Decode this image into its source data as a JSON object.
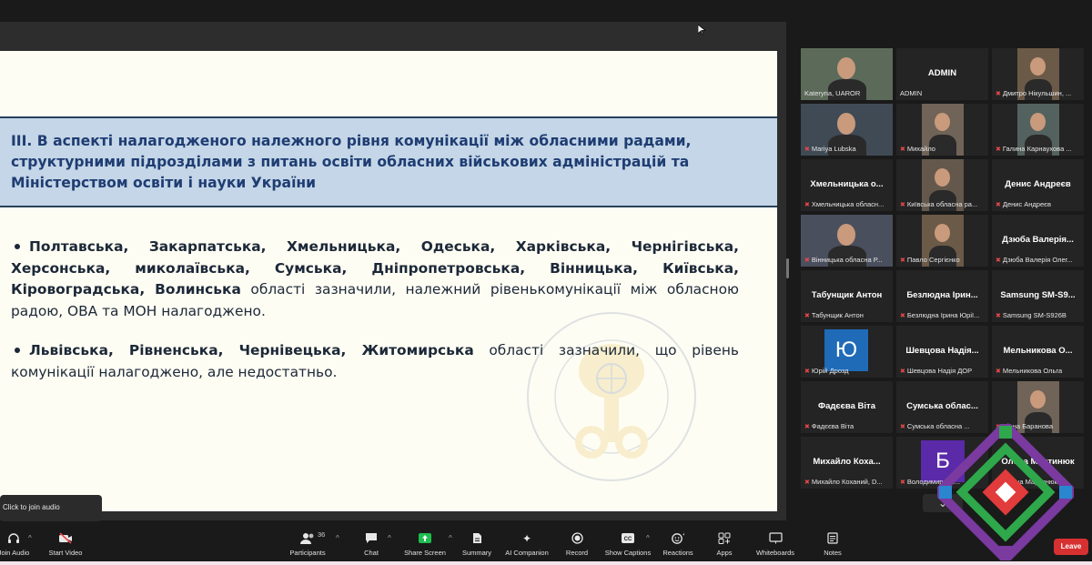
{
  "slide": {
    "heading": "III. В аспекті налагодженого належного рівня комунікації між обласними радами, структурними підрозділами з питань освіти обласних військових адміністрацій та Міністерством освіти і науки України",
    "bullet1_bold": "Полтавська, Закарпатська, Хмельницька, Одеська, Харківська, Чернігівська, Херсонська, миколаївська, Сумська, Дніпропетровська, Вінницька, Київська, Кіровоградська, Волинська",
    "bullet1_text": " області зазначили, належний рівенькомунікації між обласною радою, ОВА та МОН налагоджено.",
    "bullet2_bold": "Львівська, Рівненська, Чернівецька, Житомирська",
    "bullet2_text": " області зазначили, що рівень комунікації налагоджено, але недостатньо."
  },
  "gallery": {
    "tiles": [
      {
        "name": "",
        "label": "Kateryna, UAROR",
        "video": true,
        "active": true,
        "initial": ""
      },
      {
        "name": "ADMIN",
        "label": "ADMIN",
        "video": false,
        "active": false,
        "initial": ""
      },
      {
        "name": "",
        "label": "Дмитро Нікульшин, ...",
        "video": true,
        "active": false,
        "initial": ""
      },
      {
        "name": "",
        "label": "Mariya Lubska",
        "video": true,
        "active": false,
        "initial": ""
      },
      {
        "name": "",
        "label": "Михайло",
        "video": true,
        "active": false,
        "initial": ""
      },
      {
        "name": "",
        "label": "Галина Карнаухова ...",
        "video": true,
        "active": false,
        "initial": ""
      },
      {
        "name": "Хмельницька о...",
        "label": "Хмельницька обласн...",
        "video": false,
        "active": false,
        "initial": ""
      },
      {
        "name": "",
        "label": "Київська обласна ра...",
        "video": true,
        "active": false,
        "initial": ""
      },
      {
        "name": "Денис Андреєв",
        "label": "Денис Андреєв",
        "video": false,
        "active": false,
        "initial": ""
      },
      {
        "name": "",
        "label": "Вінницька обласна Р...",
        "video": true,
        "active": false,
        "initial": ""
      },
      {
        "name": "",
        "label": "Павло Сергієнко",
        "video": true,
        "active": false,
        "initial": ""
      },
      {
        "name": "Дзюба Валерія...",
        "label": "Дзюба Валерія Олег...",
        "video": false,
        "active": false,
        "initial": ""
      },
      {
        "name": "Табунщик Антон",
        "label": "Табунщик Антон",
        "video": false,
        "active": false,
        "initial": ""
      },
      {
        "name": "Безлюдна Ірин...",
        "label": "Безлюдна Ірина Юрії...",
        "video": false,
        "active": false,
        "initial": ""
      },
      {
        "name": "Samsung SM-S9...",
        "label": "Samsung SM-S926B",
        "video": false,
        "active": false,
        "initial": ""
      },
      {
        "name": "",
        "label": "Юрій Дрозд",
        "video": false,
        "active": false,
        "initial": "Ю"
      },
      {
        "name": "Шевцова Надія...",
        "label": "Шевцова Надія ДОР",
        "video": false,
        "active": false,
        "initial": ""
      },
      {
        "name": "Мельникова О...",
        "label": "Мельникова Ольга",
        "video": false,
        "active": false,
        "initial": ""
      },
      {
        "name": "Фадєєва Віта",
        "label": "Фадєєва Віта",
        "video": false,
        "active": false,
        "initial": ""
      },
      {
        "name": "Сумська облас...",
        "label": "Сумська обласна ...",
        "video": false,
        "active": false,
        "initial": ""
      },
      {
        "name": "",
        "label": "Діана Баранова",
        "video": true,
        "active": false,
        "initial": ""
      },
      {
        "name": "Михайло Коха...",
        "label": "Михайло Коханий, D...",
        "video": false,
        "active": false,
        "initial": ""
      },
      {
        "name": "",
        "label": "Володимир Ми...",
        "video": false,
        "active": false,
        "initial": "Б"
      },
      {
        "name": "Олена Мартинюк",
        "label": "Олена Мартинюк",
        "video": false,
        "active": false,
        "initial": ""
      }
    ]
  },
  "toolbar": {
    "join_audio": "Join Audio",
    "start_video": "Start Video",
    "participants": "Participants",
    "participants_count": "36",
    "chat": "Chat",
    "share_screen": "Share Screen",
    "summary": "Summary",
    "ai_companion": "AI Companion",
    "record": "Record",
    "show_captions": "Show Captions",
    "reactions": "Reactions",
    "apps": "Apps",
    "whiteboards": "Whiteboards",
    "notes": "Notes",
    "leave": "Leave",
    "join_tooltip": "Click to join audio"
  },
  "colors": {
    "heading_bg": "#c4d6e7",
    "heading_text": "#1f3d73",
    "share_screen_green": "#1fbd4e",
    "leave_red": "#d73030",
    "active_speaker": "#9dc43c"
  }
}
